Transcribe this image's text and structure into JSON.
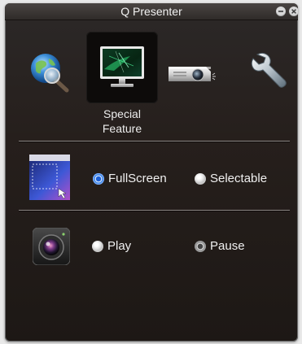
{
  "window": {
    "title": "Q Presenter",
    "controls": [
      "minimize-icon",
      "close-icon"
    ]
  },
  "tabs": [
    {
      "icon": "globe-search-icon"
    },
    {
      "icon": "monitor-icon",
      "label": "Special Feature",
      "selected": true
    },
    {
      "icon": "projector-icon"
    },
    {
      "icon": "wrench-icon"
    }
  ],
  "display_mode": {
    "icon": "display-area-icon",
    "options": [
      {
        "label": "FullScreen",
        "selected": true
      },
      {
        "label": "Selectable",
        "selected": false
      }
    ]
  },
  "playback": {
    "icon": "camera-icon",
    "options": [
      {
        "label": "Play",
        "selected": false
      },
      {
        "label": "Pause",
        "selected": true
      }
    ]
  },
  "colors": {
    "accent_blue": "#1b60d8",
    "background": "#261f1c"
  }
}
